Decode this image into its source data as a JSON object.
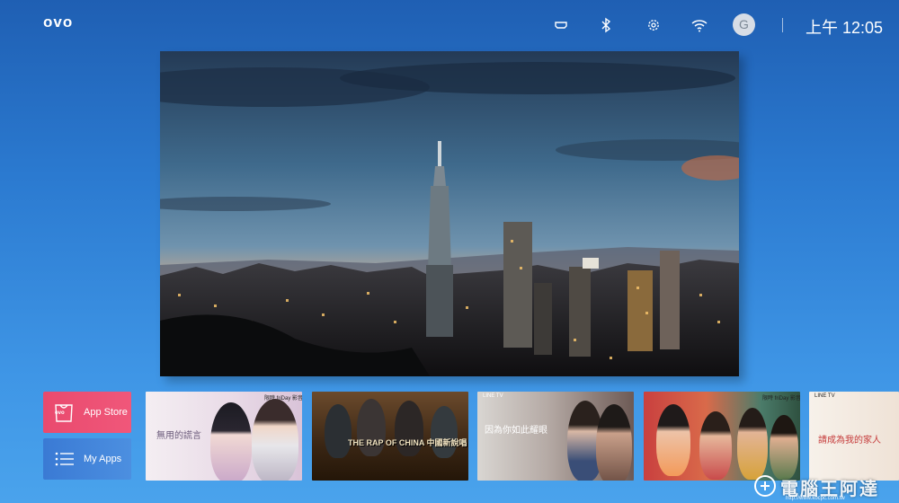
{
  "topbar": {
    "logo": "ovo",
    "clock": "上午 12:05",
    "avatar_letter": "G",
    "icons": [
      "hdmi-icon",
      "bluetooth-icon",
      "settings-icon",
      "wifi-icon"
    ]
  },
  "hero": {
    "image": "Taipei 101 skyline at dusk"
  },
  "apps": {
    "app_store_label": "App Store",
    "app_store_logo": "ovo",
    "my_apps_label": "My Apps"
  },
  "cards": [
    {
      "badge": "限時 friDay 影音",
      "title": "無用的謊言"
    },
    {
      "badge": "",
      "title": "THE RAP OF CHINA 中國新說唱"
    },
    {
      "badge": "LINE TV",
      "title": "因為你如此耀眼"
    },
    {
      "badge": "限時 friDay 影音",
      "title": ""
    },
    {
      "badge": "LINE TV",
      "title": "請成為我的家人"
    }
  ],
  "watermark": {
    "text": "電腦王阿達",
    "url": "http://www.kocpc.com.tw"
  },
  "colors": {
    "background_top": "#1f5fb3",
    "background_bottom": "#4aa3ec",
    "app_store": "#ec4f73",
    "my_apps": "#3f80d8"
  }
}
